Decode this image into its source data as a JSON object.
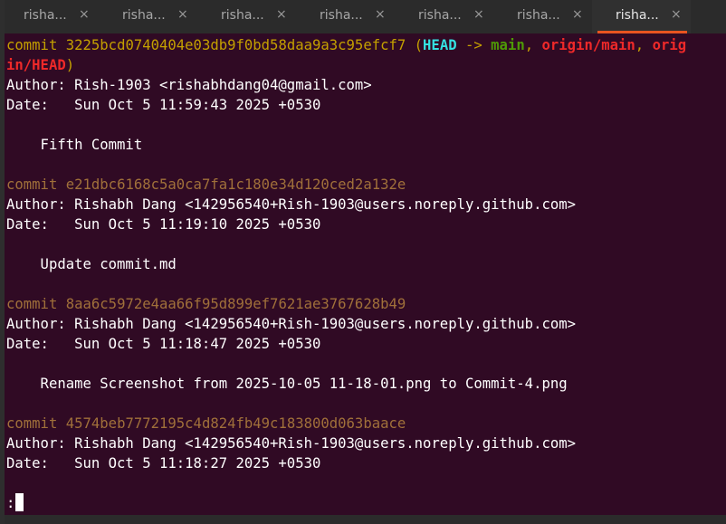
{
  "tabs": [
    {
      "label": "risha..."
    },
    {
      "label": "risha..."
    },
    {
      "label": "risha..."
    },
    {
      "label": "risha..."
    },
    {
      "label": "risha..."
    },
    {
      "label": "risha..."
    },
    {
      "label": "risha...",
      "active": true
    }
  ],
  "tab_close_glyph": "×",
  "log": {
    "c1": {
      "word": "commit",
      "hash": "3225bcd0740404e03db9f0bd58daa9a3c95efcf7",
      "open_paren": " (",
      "head": "HEAD",
      "arrow": " -> ",
      "branch": "main",
      "sep1": ", ",
      "remote1": "origin/main",
      "sep2": ", ",
      "remote2_a": "orig",
      "remote2_b": "in/HEAD",
      "close_paren": ")",
      "author": "Author: Rish-1903 <rishabhdang04@gmail.com>",
      "date": "Date:   Sun Oct 5 11:59:43 2025 +0530",
      "message": "    Fifth Commit"
    },
    "c2": {
      "word": "commit",
      "hash": "e21dbc6168c5a0ca7fa1c180e34d120ced2a132e",
      "author": "Author: Rishabh Dang <142956540+Rish-1903@users.noreply.github.com>",
      "date": "Date:   Sun Oct 5 11:19:10 2025 +0530",
      "message": "    Update commit.md"
    },
    "c3": {
      "word": "commit",
      "hash": "8aa6c5972e4aa66f95d899ef7621ae3767628b49",
      "author": "Author: Rishabh Dang <142956540+Rish-1903@users.noreply.github.com>",
      "date": "Date:   Sun Oct 5 11:18:47 2025 +0530",
      "message": "    Rename Screenshot from 2025-10-05 11-18-01.png to Commit-4.png"
    },
    "c4": {
      "word": "commit",
      "hash": "4574beb7772195c4d824fb49c183800d063baace",
      "author": "Author: Rishabh Dang <142956540+Rish-1903@users.noreply.github.com>",
      "date": "Date:   Sun Oct 5 11:18:27 2025 +0530"
    },
    "prompt": ":"
  },
  "colors": {
    "terminal_bg": "#300a24",
    "accent": "#e95420",
    "hash": "#c4a000",
    "head": "#34e2e2",
    "branch": "#4e9a06",
    "remote": "#ef2929"
  }
}
